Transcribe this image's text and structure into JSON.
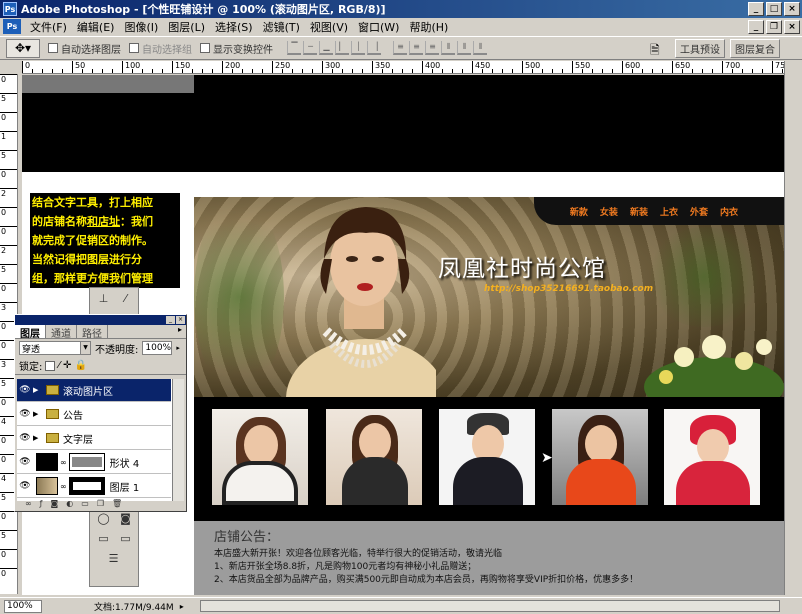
{
  "window": {
    "title": "Adobe Photoshop - [个性旺铺设计 @ 100% (滚动图片区, RGB/8)]",
    "app_icon": "Ps"
  },
  "menubar": {
    "items": [
      "文件(F)",
      "编辑(E)",
      "图像(I)",
      "图层(L)",
      "选择(S)",
      "滤镜(T)",
      "视图(V)",
      "窗口(W)",
      "帮助(H)"
    ]
  },
  "options": {
    "auto_select_layer": "自动选择图层",
    "auto_select_group": "自动选择组",
    "show_transform": "显示变换控件",
    "well_tools": "工具预设",
    "well_layer_comps": "图层复合"
  },
  "ruler": {
    "h_labels": [
      "0",
      "50",
      "100",
      "150",
      "200",
      "250",
      "300",
      "350",
      "400",
      "450",
      "500",
      "550",
      "600",
      "650",
      "700",
      "750"
    ],
    "v_labels": [
      "0",
      "5",
      "0",
      "1",
      "5",
      "0",
      "2",
      "0",
      "0",
      "2",
      "5",
      "0",
      "3",
      "0",
      "0",
      "3",
      "5",
      "0",
      "4",
      "0",
      "0",
      "4",
      "5",
      "0",
      "5",
      "0",
      "0"
    ]
  },
  "annotation": {
    "line1": "结合文字工具，打上相应",
    "line2a": "的店铺名称",
    "line2b": "和店址",
    "line2c": "：我们",
    "line3": "就完成了促销区的制作。",
    "line4": "当然记得把图层进行分",
    "line5": "组，那样更方便我们管理"
  },
  "hero": {
    "nav": [
      "新款",
      "女装",
      "新装",
      "上衣",
      "外套",
      "内衣"
    ],
    "shop_name": "凤凰社时尚公馆",
    "shop_url": "http://shop35216691.taobao.com"
  },
  "notice": {
    "title": "店铺公告：",
    "line1": "本店盛大新开张！欢迎各位顾客光临，特举行很大的促销活动，敬请光临",
    "line2": "1、新店开张全场8.8折，凡是购物100元者均有神秘小礼品赠送；",
    "line3": "2、本店货品全部为品牌产品，购买满500元即自动成为本店会员，再购物将享受VIP折扣价格，优惠多多！"
  },
  "layers_panel": {
    "tabs": [
      "图层",
      "通道",
      "路径"
    ],
    "blend_mode": "穿透",
    "opacity_label": "不透明度:",
    "opacity_value": "100%",
    "lock_label": "锁定:",
    "layers": [
      {
        "name": "滚动图片区",
        "type": "group",
        "active": true
      },
      {
        "name": "公告",
        "type": "group",
        "active": false
      },
      {
        "name": "文字层",
        "type": "group",
        "active": false
      },
      {
        "name": "形状 4",
        "type": "shape",
        "active": false
      },
      {
        "name": "图层 1",
        "type": "pixel",
        "active": false
      }
    ]
  },
  "statusbar": {
    "zoom": "100%",
    "doc_info": "文档:1.77M/9.44M"
  },
  "colors": {
    "titlebar": "#0a246a",
    "annotation_text": "#ffef00",
    "nav_text": "#f07a20",
    "url_text": "#f4b020",
    "notice_bg": "#9c9c9c"
  }
}
